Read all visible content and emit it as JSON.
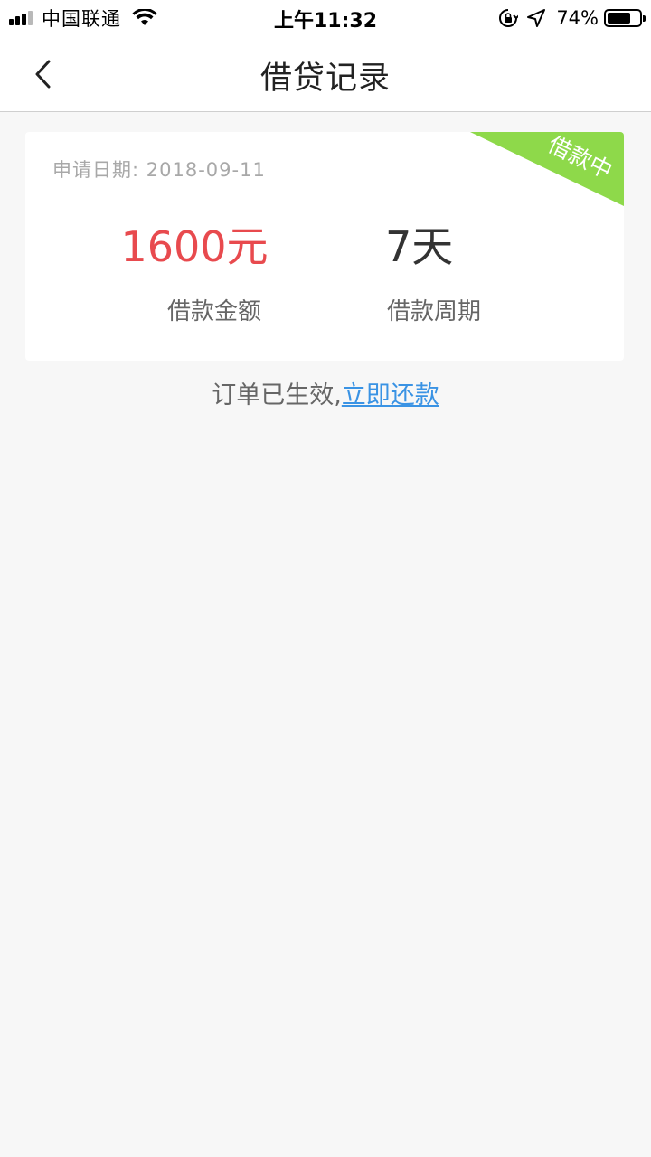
{
  "status_bar": {
    "carrier": "中国联通",
    "time": "上午11:32",
    "battery_percent": "74%",
    "battery_level": 0.74,
    "icons": [
      "signal-icon",
      "wifi-icon",
      "rotation-lock-icon",
      "location-arrow-icon",
      "battery-icon"
    ]
  },
  "nav": {
    "title": "借贷记录",
    "back_icon": "chevron-left-icon"
  },
  "loan": {
    "date_label": "申请日期:",
    "date_value": "2018-09-11",
    "status_badge": "借款中",
    "status_color": "#8ed94a",
    "amount_value": "1600元",
    "amount_label": "借款金额",
    "amount_color": "#e84a4e",
    "period_value": "7天",
    "period_label": "借款周期"
  },
  "notice": {
    "text": "订单已生效,",
    "link": "立即还款",
    "link_color": "#3a93e4"
  }
}
